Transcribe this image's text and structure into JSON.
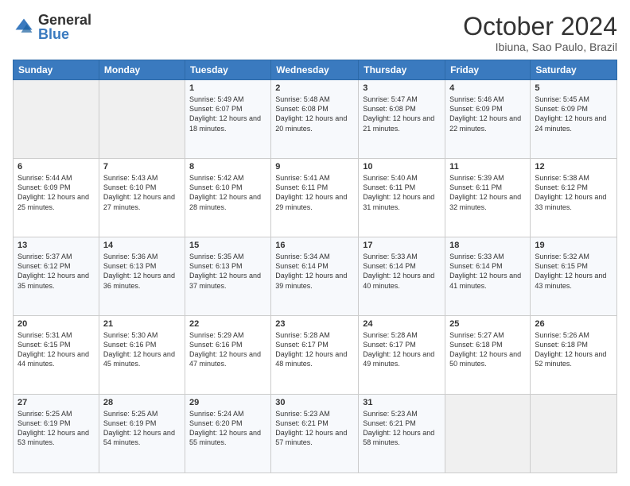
{
  "logo": {
    "general": "General",
    "blue": "Blue"
  },
  "header": {
    "month": "October 2024",
    "location": "Ibiuna, Sao Paulo, Brazil"
  },
  "weekdays": [
    "Sunday",
    "Monday",
    "Tuesday",
    "Wednesday",
    "Thursday",
    "Friday",
    "Saturday"
  ],
  "weeks": [
    [
      {
        "day": "",
        "sunrise": "",
        "sunset": "",
        "daylight": ""
      },
      {
        "day": "",
        "sunrise": "",
        "sunset": "",
        "daylight": ""
      },
      {
        "day": "1",
        "sunrise": "Sunrise: 5:49 AM",
        "sunset": "Sunset: 6:07 PM",
        "daylight": "Daylight: 12 hours and 18 minutes."
      },
      {
        "day": "2",
        "sunrise": "Sunrise: 5:48 AM",
        "sunset": "Sunset: 6:08 PM",
        "daylight": "Daylight: 12 hours and 20 minutes."
      },
      {
        "day": "3",
        "sunrise": "Sunrise: 5:47 AM",
        "sunset": "Sunset: 6:08 PM",
        "daylight": "Daylight: 12 hours and 21 minutes."
      },
      {
        "day": "4",
        "sunrise": "Sunrise: 5:46 AM",
        "sunset": "Sunset: 6:09 PM",
        "daylight": "Daylight: 12 hours and 22 minutes."
      },
      {
        "day": "5",
        "sunrise": "Sunrise: 5:45 AM",
        "sunset": "Sunset: 6:09 PM",
        "daylight": "Daylight: 12 hours and 24 minutes."
      }
    ],
    [
      {
        "day": "6",
        "sunrise": "Sunrise: 5:44 AM",
        "sunset": "Sunset: 6:09 PM",
        "daylight": "Daylight: 12 hours and 25 minutes."
      },
      {
        "day": "7",
        "sunrise": "Sunrise: 5:43 AM",
        "sunset": "Sunset: 6:10 PM",
        "daylight": "Daylight: 12 hours and 27 minutes."
      },
      {
        "day": "8",
        "sunrise": "Sunrise: 5:42 AM",
        "sunset": "Sunset: 6:10 PM",
        "daylight": "Daylight: 12 hours and 28 minutes."
      },
      {
        "day": "9",
        "sunrise": "Sunrise: 5:41 AM",
        "sunset": "Sunset: 6:11 PM",
        "daylight": "Daylight: 12 hours and 29 minutes."
      },
      {
        "day": "10",
        "sunrise": "Sunrise: 5:40 AM",
        "sunset": "Sunset: 6:11 PM",
        "daylight": "Daylight: 12 hours and 31 minutes."
      },
      {
        "day": "11",
        "sunrise": "Sunrise: 5:39 AM",
        "sunset": "Sunset: 6:11 PM",
        "daylight": "Daylight: 12 hours and 32 minutes."
      },
      {
        "day": "12",
        "sunrise": "Sunrise: 5:38 AM",
        "sunset": "Sunset: 6:12 PM",
        "daylight": "Daylight: 12 hours and 33 minutes."
      }
    ],
    [
      {
        "day": "13",
        "sunrise": "Sunrise: 5:37 AM",
        "sunset": "Sunset: 6:12 PM",
        "daylight": "Daylight: 12 hours and 35 minutes."
      },
      {
        "day": "14",
        "sunrise": "Sunrise: 5:36 AM",
        "sunset": "Sunset: 6:13 PM",
        "daylight": "Daylight: 12 hours and 36 minutes."
      },
      {
        "day": "15",
        "sunrise": "Sunrise: 5:35 AM",
        "sunset": "Sunset: 6:13 PM",
        "daylight": "Daylight: 12 hours and 37 minutes."
      },
      {
        "day": "16",
        "sunrise": "Sunrise: 5:34 AM",
        "sunset": "Sunset: 6:14 PM",
        "daylight": "Daylight: 12 hours and 39 minutes."
      },
      {
        "day": "17",
        "sunrise": "Sunrise: 5:33 AM",
        "sunset": "Sunset: 6:14 PM",
        "daylight": "Daylight: 12 hours and 40 minutes."
      },
      {
        "day": "18",
        "sunrise": "Sunrise: 5:33 AM",
        "sunset": "Sunset: 6:14 PM",
        "daylight": "Daylight: 12 hours and 41 minutes."
      },
      {
        "day": "19",
        "sunrise": "Sunrise: 5:32 AM",
        "sunset": "Sunset: 6:15 PM",
        "daylight": "Daylight: 12 hours and 43 minutes."
      }
    ],
    [
      {
        "day": "20",
        "sunrise": "Sunrise: 5:31 AM",
        "sunset": "Sunset: 6:15 PM",
        "daylight": "Daylight: 12 hours and 44 minutes."
      },
      {
        "day": "21",
        "sunrise": "Sunrise: 5:30 AM",
        "sunset": "Sunset: 6:16 PM",
        "daylight": "Daylight: 12 hours and 45 minutes."
      },
      {
        "day": "22",
        "sunrise": "Sunrise: 5:29 AM",
        "sunset": "Sunset: 6:16 PM",
        "daylight": "Daylight: 12 hours and 47 minutes."
      },
      {
        "day": "23",
        "sunrise": "Sunrise: 5:28 AM",
        "sunset": "Sunset: 6:17 PM",
        "daylight": "Daylight: 12 hours and 48 minutes."
      },
      {
        "day": "24",
        "sunrise": "Sunrise: 5:28 AM",
        "sunset": "Sunset: 6:17 PM",
        "daylight": "Daylight: 12 hours and 49 minutes."
      },
      {
        "day": "25",
        "sunrise": "Sunrise: 5:27 AM",
        "sunset": "Sunset: 6:18 PM",
        "daylight": "Daylight: 12 hours and 50 minutes."
      },
      {
        "day": "26",
        "sunrise": "Sunrise: 5:26 AM",
        "sunset": "Sunset: 6:18 PM",
        "daylight": "Daylight: 12 hours and 52 minutes."
      }
    ],
    [
      {
        "day": "27",
        "sunrise": "Sunrise: 5:25 AM",
        "sunset": "Sunset: 6:19 PM",
        "daylight": "Daylight: 12 hours and 53 minutes."
      },
      {
        "day": "28",
        "sunrise": "Sunrise: 5:25 AM",
        "sunset": "Sunset: 6:19 PM",
        "daylight": "Daylight: 12 hours and 54 minutes."
      },
      {
        "day": "29",
        "sunrise": "Sunrise: 5:24 AM",
        "sunset": "Sunset: 6:20 PM",
        "daylight": "Daylight: 12 hours and 55 minutes."
      },
      {
        "day": "30",
        "sunrise": "Sunrise: 5:23 AM",
        "sunset": "Sunset: 6:21 PM",
        "daylight": "Daylight: 12 hours and 57 minutes."
      },
      {
        "day": "31",
        "sunrise": "Sunrise: 5:23 AM",
        "sunset": "Sunset: 6:21 PM",
        "daylight": "Daylight: 12 hours and 58 minutes."
      },
      {
        "day": "",
        "sunrise": "",
        "sunset": "",
        "daylight": ""
      },
      {
        "day": "",
        "sunrise": "",
        "sunset": "",
        "daylight": ""
      }
    ]
  ]
}
